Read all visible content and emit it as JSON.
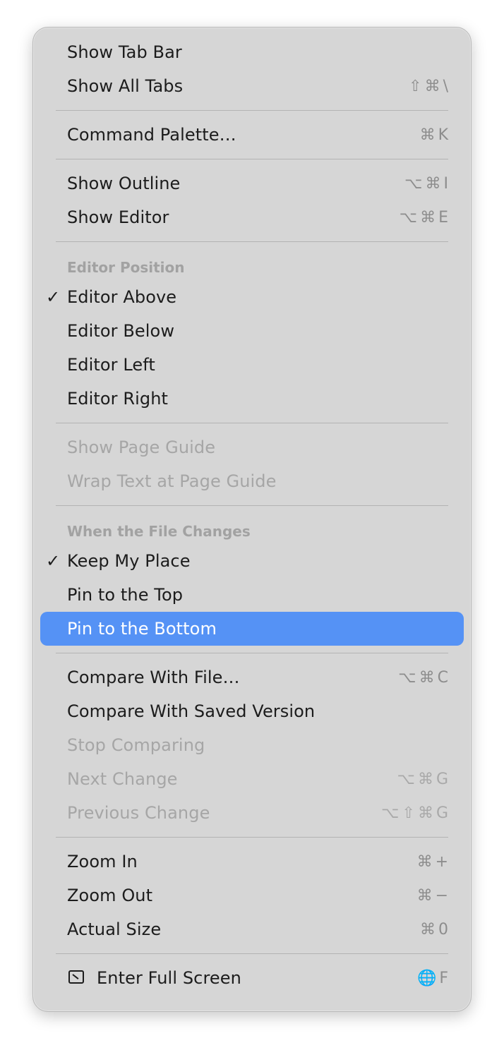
{
  "menu": {
    "tabs": {
      "show_tab_bar": "Show Tab Bar",
      "show_all_tabs": "Show All Tabs",
      "show_all_tabs_shortcut": "⇧⌘\\"
    },
    "palette": {
      "command_palette": "Command Palette…",
      "command_palette_shortcut": "⌘K"
    },
    "view": {
      "show_outline": "Show Outline",
      "show_outline_shortcut": "⌥⌘I",
      "show_editor": "Show Editor",
      "show_editor_shortcut": "⌥⌘E"
    },
    "editor_position": {
      "header": "Editor Position",
      "check": "✓",
      "above": "Editor Above",
      "below": "Editor Below",
      "left": "Editor Left",
      "right": "Editor Right"
    },
    "page_guide": {
      "show": "Show Page Guide",
      "wrap": "Wrap Text at Page Guide"
    },
    "file_changes": {
      "header": "When the File Changes",
      "check": "✓",
      "keep_place": "Keep My Place",
      "pin_top": "Pin to the Top",
      "pin_bottom": "Pin to the Bottom"
    },
    "compare": {
      "with_file": "Compare With File…",
      "with_file_shortcut": "⌥⌘C",
      "with_saved": "Compare With Saved Version",
      "stop": "Stop Comparing",
      "next": "Next Change",
      "next_shortcut": "⌥⌘G",
      "previous": "Previous Change",
      "previous_shortcut": "⌥⇧⌘G"
    },
    "zoom": {
      "in": "Zoom In",
      "in_shortcut": "⌘+",
      "out": "Zoom Out",
      "out_shortcut": "⌘−",
      "actual": "Actual Size",
      "actual_shortcut": "⌘0"
    },
    "fullscreen": {
      "label": "Enter Full Screen",
      "shortcut": "🌐F",
      "icon": "fullscreen-icon"
    }
  },
  "colors": {
    "menu_bg": "#d6d6d6",
    "highlight": "#5592f5",
    "disabled_text": "#a6a6a6",
    "shortcut_text": "#8d8d8d"
  }
}
